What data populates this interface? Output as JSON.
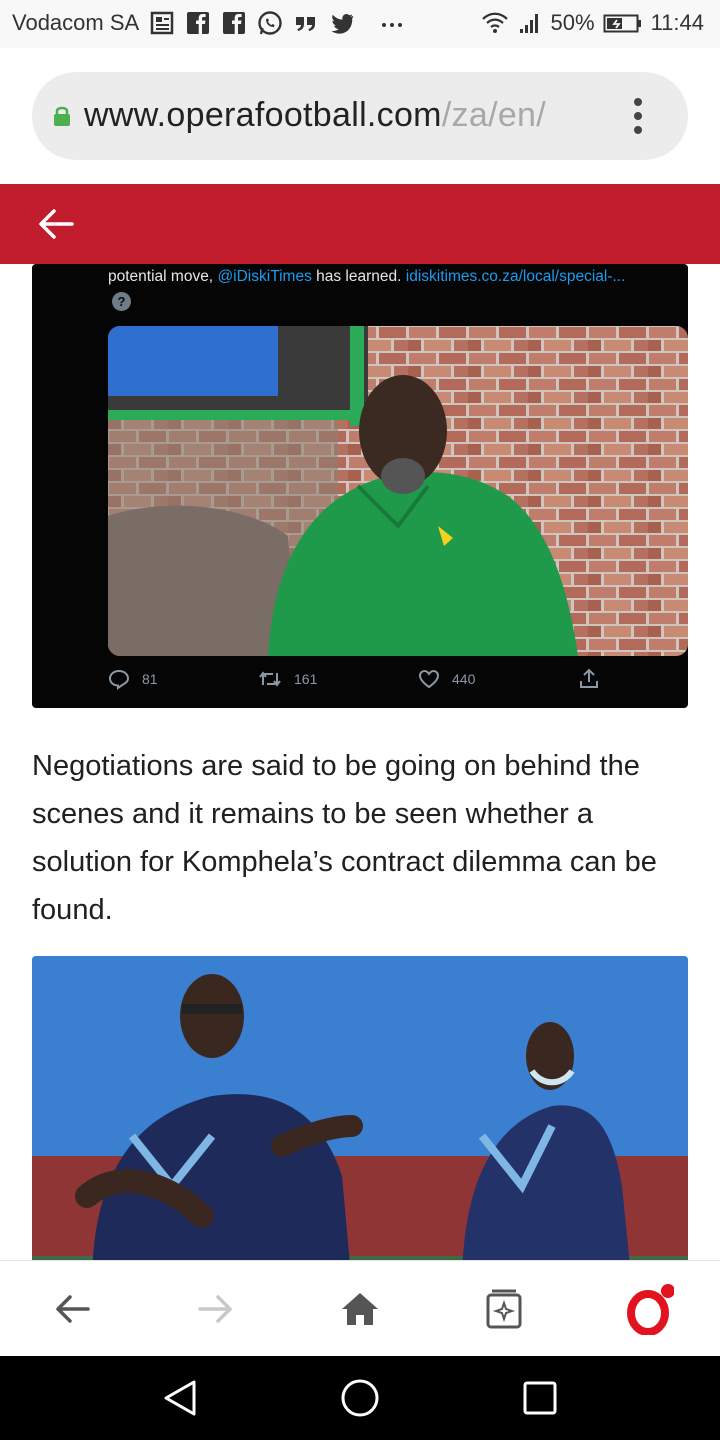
{
  "status_bar": {
    "carrier": "Vodacom SA",
    "battery": "50%",
    "time": "11:44",
    "notification_icons": [
      "news-icon",
      "facebook-icon",
      "facebook-icon",
      "whatsapp-icon",
      "quote-icon",
      "twitter-icon",
      "more-dots-icon"
    ],
    "right_icons": [
      "wifi-icon",
      "signal-icon",
      "battery-icon"
    ]
  },
  "browser": {
    "url_domain": "www.operafootball.com",
    "url_path": "/za/en/",
    "accent_color": "#c21d2c"
  },
  "tweet": {
    "text_prefix": "potential move, ",
    "mention": "@iDiskiTimes",
    "text_middle": " has learned. ",
    "link": "idiskitimes.co.za/local/special-...",
    "badge": "?",
    "reply_count": "81",
    "retweet_count": "161",
    "like_count": "440"
  },
  "article": {
    "paragraph": "Negotiations are said to be going on behind the scenes and it remains to be seen whether a solution for Komphela’s contract dilemma can be found."
  },
  "bottom_nav": {
    "items": [
      "back-icon",
      "forward-icon",
      "home-icon",
      "tabs-icon",
      "opera-menu-icon"
    ]
  },
  "system_nav": {
    "items": [
      "back-triangle-icon",
      "home-circle-icon",
      "recents-square-icon"
    ]
  }
}
